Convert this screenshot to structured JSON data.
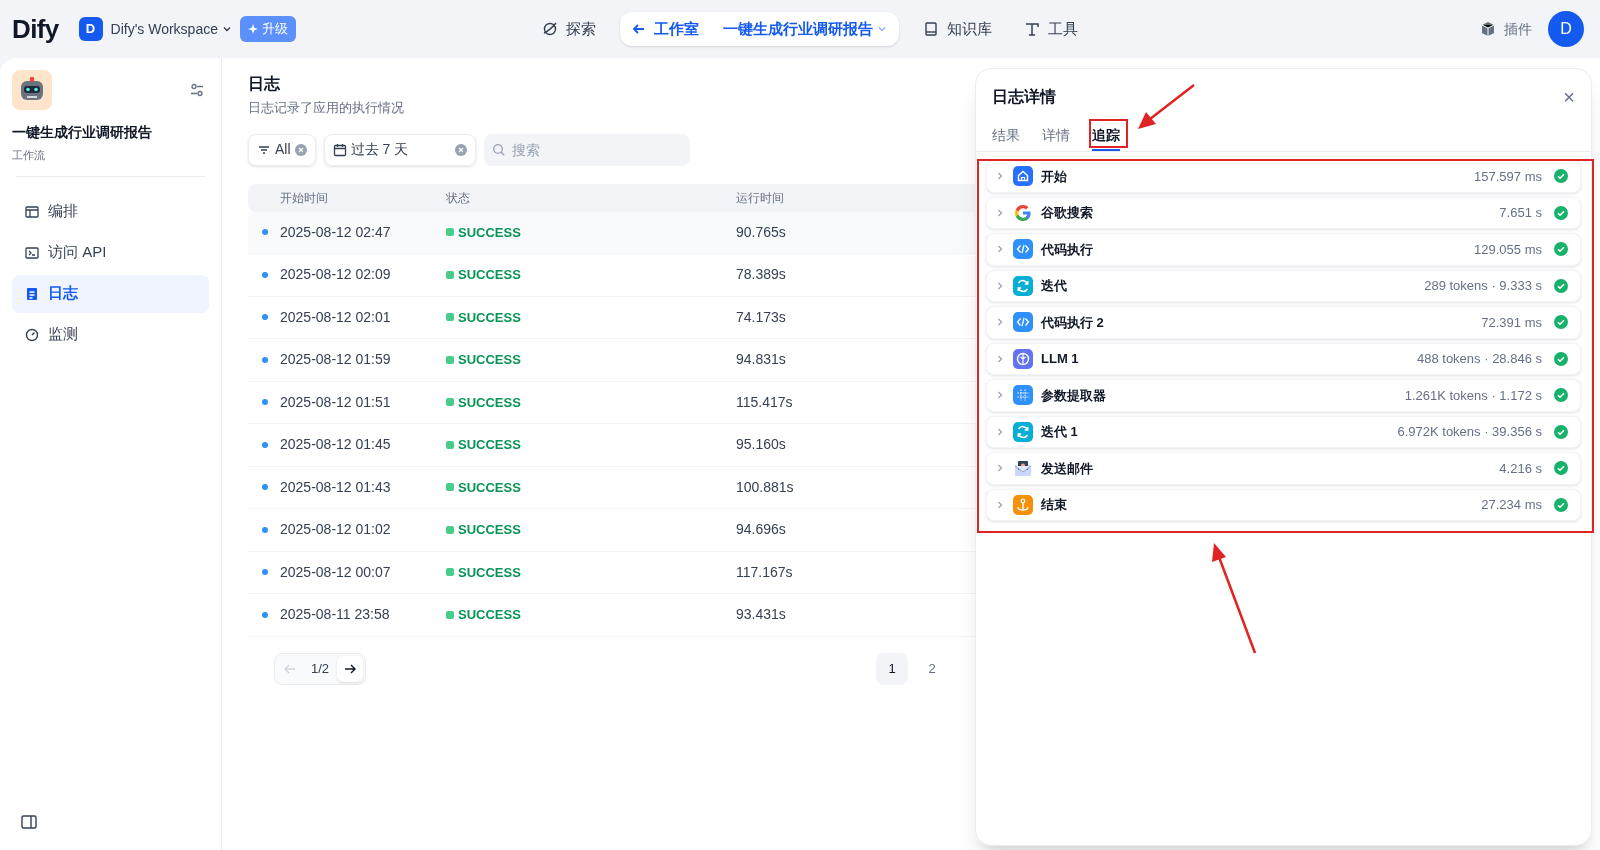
{
  "top_nav": {
    "logo": "Dify",
    "workspace_initial": "D",
    "workspace": "Dify's Workspace",
    "upgrade": "升级",
    "explore": "探索",
    "breadcrumb": {
      "back": "工作室",
      "app": "一键生成行业调研报告"
    },
    "knowledge": "知识库",
    "tools": "工具",
    "plugins": "插件",
    "avatar": "D"
  },
  "sidebar": {
    "app_name": "一键生成行业调研报告",
    "app_type": "工作流",
    "items": [
      {
        "label": "编排",
        "kind": "orchestrate",
        "selected": false
      },
      {
        "label": "访问 API",
        "kind": "api",
        "selected": false
      },
      {
        "label": "日志",
        "kind": "logs",
        "selected": true
      },
      {
        "label": "监测",
        "kind": "monitor",
        "selected": false
      }
    ]
  },
  "logs": {
    "title": "日志",
    "subtitle": "日志记录了应用的执行情况",
    "filters": {
      "status": "All",
      "period": "过去 7 天",
      "search_placeholder": "搜索"
    },
    "table": {
      "columns": [
        "开始时间",
        "状态",
        "运行时间"
      ],
      "rows": [
        {
          "start": "2025-08-12 02:47",
          "status": "SUCCESS",
          "duration": "90.765s"
        },
        {
          "start": "2025-08-12 02:09",
          "status": "SUCCESS",
          "duration": "78.389s"
        },
        {
          "start": "2025-08-12 02:01",
          "status": "SUCCESS",
          "duration": "74.173s"
        },
        {
          "start": "2025-08-12 01:59",
          "status": "SUCCESS",
          "duration": "94.831s"
        },
        {
          "start": "2025-08-12 01:51",
          "status": "SUCCESS",
          "duration": "115.417s"
        },
        {
          "start": "2025-08-12 01:45",
          "status": "SUCCESS",
          "duration": "95.160s"
        },
        {
          "start": "2025-08-12 01:43",
          "status": "SUCCESS",
          "duration": "100.881s"
        },
        {
          "start": "2025-08-12 01:02",
          "status": "SUCCESS",
          "duration": "94.696s"
        },
        {
          "start": "2025-08-12 00:07",
          "status": "SUCCESS",
          "duration": "117.167s"
        },
        {
          "start": "2025-08-11 23:58",
          "status": "SUCCESS",
          "duration": "93.431s"
        }
      ]
    },
    "pagination": {
      "indicator": "1/2",
      "pages": [
        {
          "label": "1",
          "selected": true
        },
        {
          "label": "2",
          "selected": false
        }
      ]
    }
  },
  "detail_panel": {
    "title": "日志详情",
    "close": "×",
    "tabs": [
      {
        "label": "结果",
        "selected": false
      },
      {
        "label": "详情",
        "selected": false
      },
      {
        "label": "追踪",
        "selected": true
      }
    ],
    "nodes": [
      {
        "kind": "start",
        "name": "开始",
        "stats": "157.597 ms"
      },
      {
        "kind": "google",
        "name": "谷歌搜索",
        "stats": "7.651 s"
      },
      {
        "kind": "code",
        "name": "代码执行",
        "stats": "129.055 ms"
      },
      {
        "kind": "iteration",
        "name": "迭代",
        "stats": "289 tokens · 9.333 s"
      },
      {
        "kind": "code",
        "name": "代码执行 2",
        "stats": "72.391 ms"
      },
      {
        "kind": "llm",
        "name": "LLM 1",
        "stats": "488 tokens · 28.846 s"
      },
      {
        "kind": "param",
        "name": "参数提取器",
        "stats": "1.261K tokens · 1.172 s"
      },
      {
        "kind": "iteration",
        "name": "迭代 1",
        "stats": "6.972K tokens · 39.356 s"
      },
      {
        "kind": "mail",
        "name": "发送邮件",
        "stats": "4.216 s"
      },
      {
        "kind": "end",
        "name": "结束",
        "stats": "27.234 ms"
      }
    ]
  }
}
